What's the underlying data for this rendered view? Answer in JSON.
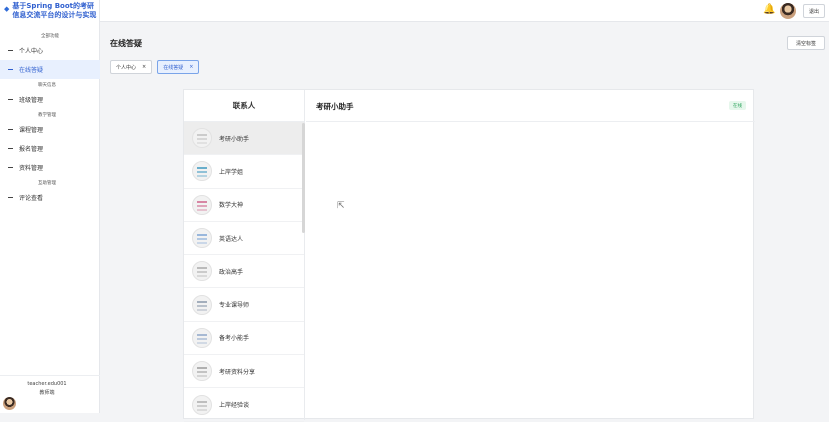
{
  "app": {
    "title": "基于Spring Boot的考研信息交流平台的设计与实现"
  },
  "sidebar": {
    "items": [
      {
        "label": "全部功能",
        "type": "sub-center"
      },
      {
        "label": "个人中心",
        "type": "main"
      },
      {
        "label": "在线答疑",
        "type": "main",
        "active": true
      },
      {
        "label": "聊天信息",
        "type": "sub"
      },
      {
        "label": "班级管理",
        "type": "main"
      },
      {
        "label": "教学管理",
        "type": "sub"
      },
      {
        "label": "课程管理",
        "type": "main"
      },
      {
        "label": "报名管理",
        "type": "main"
      },
      {
        "label": "资料管理",
        "type": "main"
      },
      {
        "label": "互助管理",
        "type": "sub"
      },
      {
        "label": "评论查看",
        "type": "main"
      }
    ],
    "user": {
      "name": "teacher.edu001",
      "role": "教师端"
    }
  },
  "topbar": {
    "logout_label": "退出"
  },
  "page": {
    "title": "在线答疑",
    "clear_tabs_label": "清空标签"
  },
  "tabs": [
    {
      "label": "个人中心",
      "active": false
    },
    {
      "label": "在线答疑",
      "active": true
    }
  ],
  "chat": {
    "contacts_header": "联系人",
    "contacts": [
      {
        "name": "考研小助手",
        "selected": true,
        "color": "#c8c8c8"
      },
      {
        "name": "上岸学姐",
        "color": "#5aa6c7"
      },
      {
        "name": "数学大神",
        "color": "#d47a9b"
      },
      {
        "name": "英语达人",
        "color": "#8fb0d9"
      },
      {
        "name": "政治高手",
        "color": "#b5b5b5"
      },
      {
        "name": "专业课导师",
        "color": "#9aa6b6"
      },
      {
        "name": "备考小能手",
        "color": "#9fb3cf"
      },
      {
        "name": "考研资料分享",
        "color": "#a9a9a9"
      },
      {
        "name": "上岸经验谈",
        "color": "#b8b8b8"
      }
    ],
    "conversation_title": "考研小助手",
    "status": "在线"
  },
  "colors": {
    "accent": "#2f5fcf",
    "online": "#2ba35b"
  }
}
